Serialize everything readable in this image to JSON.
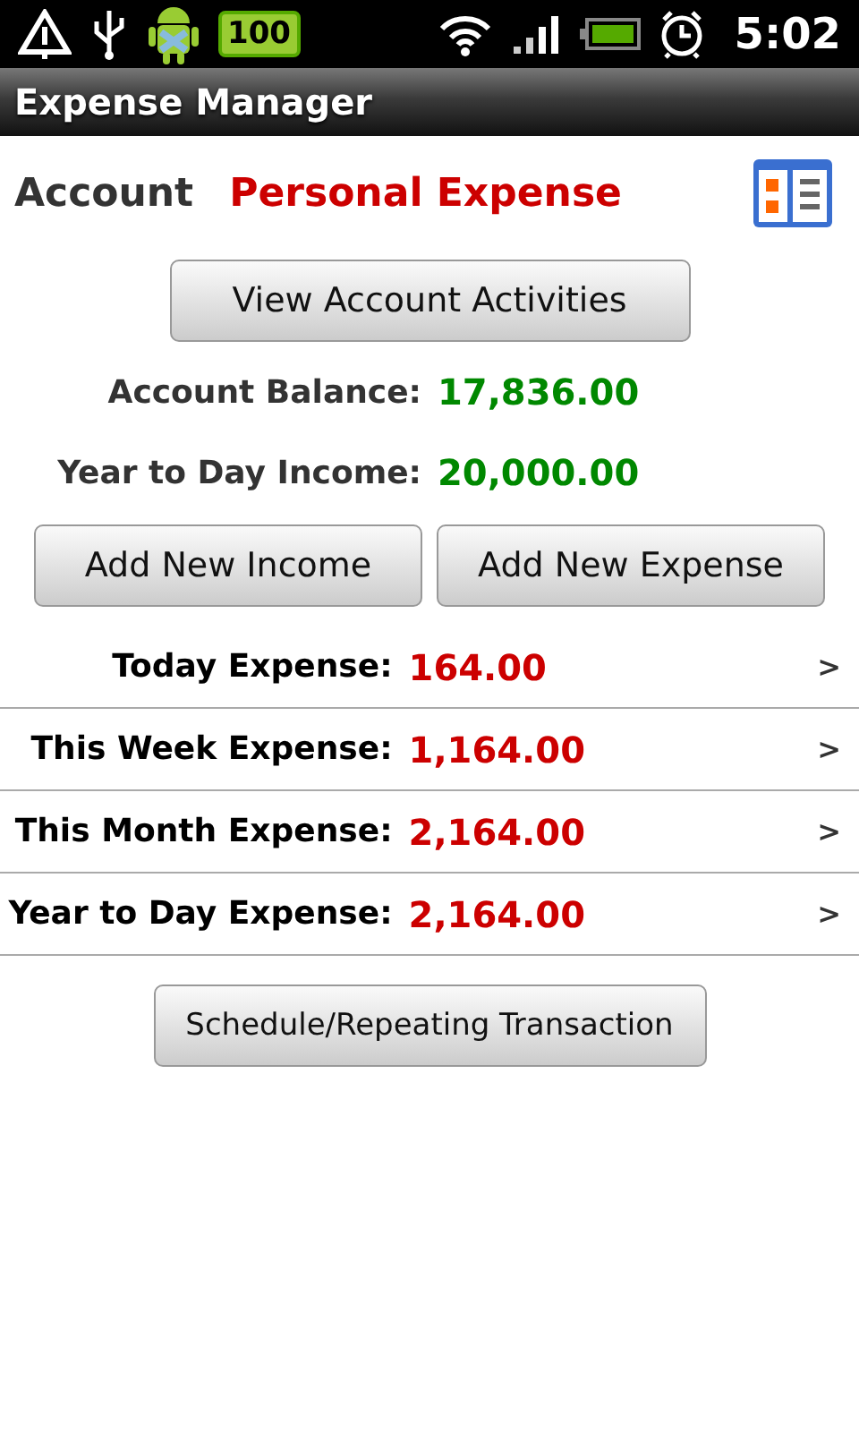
{
  "status_bar": {
    "battery_badge": "100",
    "time": "5:02"
  },
  "title": "Expense Manager",
  "account": {
    "label": "Account",
    "name": "Personal Expense"
  },
  "view_button": "View Account Activities",
  "summary": [
    {
      "label": "Account Balance:",
      "value": "17,836.00"
    },
    {
      "label": "Year to Day Income:",
      "value": "20,000.00"
    }
  ],
  "add_buttons": [
    "Add New Income",
    "Add New Expense"
  ],
  "periods": [
    {
      "label": "Today Expense:",
      "value": "164.00",
      "chevron": ">"
    },
    {
      "label": "This Week Expense:",
      "value": "1,164.00",
      "chevron": ">"
    },
    {
      "label": "This Month Expense:",
      "value": "2,164.00",
      "chevron": ">"
    },
    {
      "label": "Year to Day Expense:",
      "value": "2,164.00",
      "chevron": ">"
    }
  ],
  "schedule_button": "Schedule/Repeating Transaction"
}
